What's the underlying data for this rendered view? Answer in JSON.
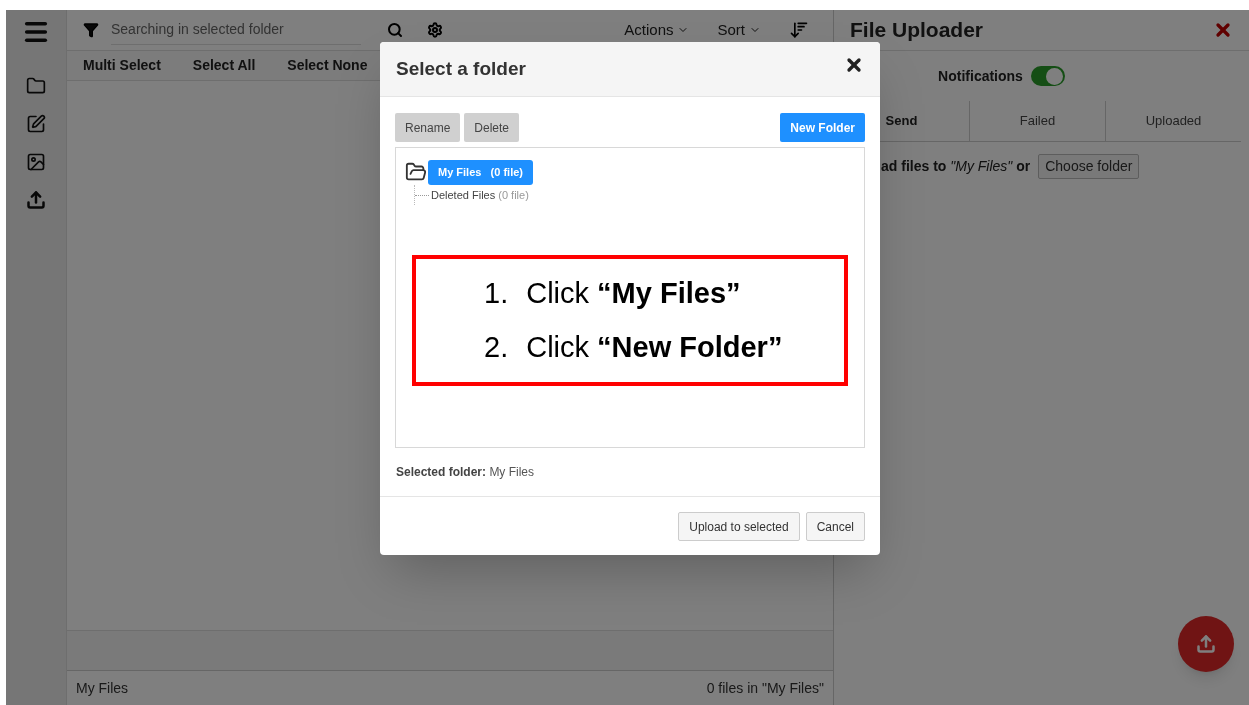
{
  "top_bar": {
    "search": {
      "placeholder": "Searching in selected folder"
    },
    "menus": [
      "Actions",
      "Sort"
    ]
  },
  "toolbar": [
    "Multi Select",
    "Select All",
    "Select None"
  ],
  "status_bar": {
    "left": "My Files",
    "right": "0 files in \"My Files\""
  },
  "uploader": {
    "title": "File Uploader",
    "notifications": {
      "label": "Notifications",
      "on": true
    },
    "tabs": [
      {
        "label": "Send",
        "selected": true
      },
      {
        "label": "Failed",
        "selected": false
      },
      {
        "label": "Uploaded",
        "selected": false
      }
    ],
    "destination": "**ad files to** *\"My Files\"* **or**",
    "choose_button": "Choose folder"
  },
  "dialog": {
    "title": "Select a folder",
    "buttons": [
      {
        "label": "Rename",
        "kind": "secondary"
      },
      {
        "label": "Delete",
        "kind": "secondary"
      },
      {
        "label": "New Folder",
        "kind": "primary"
      }
    ],
    "tree": [
      {
        "label": "My Files",
        "count": "(0 file)",
        "selected": true,
        "expanded": true,
        "children": [
          {
            "label": "Deleted Files",
            "count": "(0 file)",
            "selected": false
          }
        ]
      }
    ],
    "annotation": [
      {
        "number": "1.",
        "text": "Click **“My Files”**"
      },
      {
        "number": "2.",
        "text": "Click **“New Folder”**"
      }
    ],
    "selected_folder": {
      "label": "Selected folder:",
      "value": "My Files"
    },
    "footer_buttons": [
      "Upload to selected",
      "Cancel"
    ]
  }
}
